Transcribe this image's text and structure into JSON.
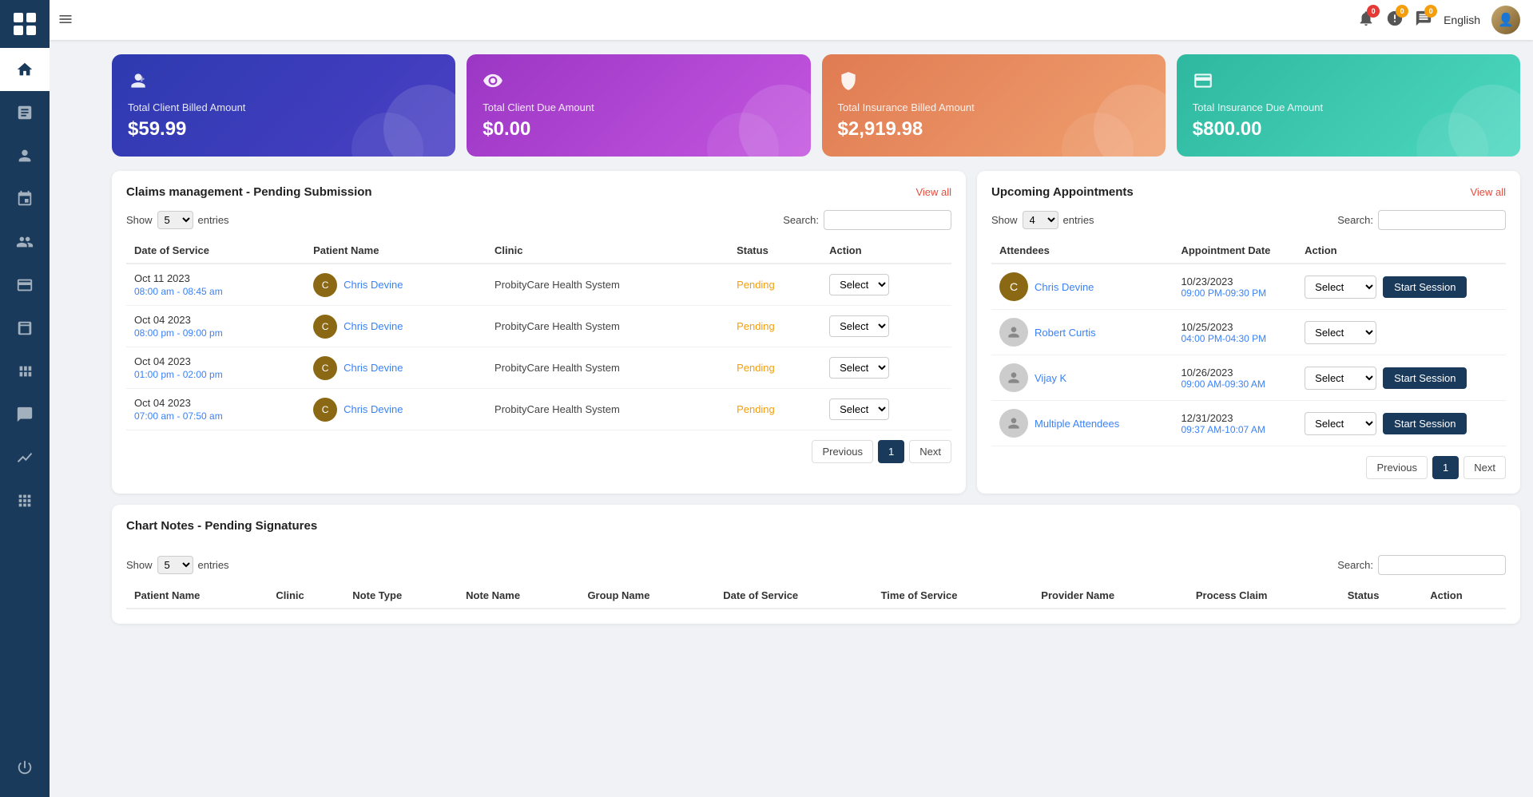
{
  "topbar": {
    "hamburger_label": "☰",
    "language": "English",
    "notification_count": "0",
    "alert_count": "0",
    "message_count": "0"
  },
  "summary_cards": [
    {
      "id": "total-client-billed",
      "title": "Total Client Billed Amount",
      "amount": "$59.99",
      "color": "card-1"
    },
    {
      "id": "total-client-due",
      "title": "Total Client Due Amount",
      "amount": "$0.00",
      "color": "card-2"
    },
    {
      "id": "total-insurance-billed",
      "title": "Total Insurance Billed Amount",
      "amount": "$2,919.98",
      "color": "card-3"
    },
    {
      "id": "total-insurance-due",
      "title": "Total Insurance Due Amount",
      "amount": "$800.00",
      "color": "card-4"
    }
  ],
  "claims": {
    "title": "Claims management - Pending Submission",
    "view_all": "View all",
    "show_label": "Show",
    "entries_label": "entries",
    "search_label": "Search:",
    "show_count": "5",
    "columns": [
      "Date of Service",
      "Patient Name",
      "Clinic",
      "Status",
      "Action"
    ],
    "rows": [
      {
        "date": "Oct 11 2023",
        "time": "08:00 am - 08:45 am",
        "patient": "Chris Devine",
        "clinic": "ProbityCare Health System",
        "status": "Pending"
      },
      {
        "date": "Oct 04 2023",
        "time": "08:00 pm - 09:00 pm",
        "patient": "Chris Devine",
        "clinic": "ProbityCare Health System",
        "status": "Pending"
      },
      {
        "date": "Oct 04 2023",
        "time": "01:00 pm - 02:00 pm",
        "patient": "Chris Devine",
        "clinic": "ProbityCare Health System",
        "status": "Pending"
      },
      {
        "date": "Oct 04 2023",
        "time": "07:00 am - 07:50 am",
        "patient": "Chris Devine",
        "clinic": "ProbityCare Health System",
        "status": "Pending"
      }
    ],
    "pagination": {
      "previous": "Previous",
      "next": "Next",
      "current_page": 1
    }
  },
  "appointments": {
    "title": "Upcoming Appointments",
    "view_all": "View all",
    "show_label": "Show",
    "entries_label": "entries",
    "show_count": "4",
    "search_label": "Search:",
    "columns": [
      "Attendees",
      "Appointment Date",
      "Action"
    ],
    "rows": [
      {
        "name": "Chris Devine",
        "has_photo": true,
        "date": "10/23/2023",
        "time": "09:00 PM-09:30 PM",
        "has_start": true
      },
      {
        "name": "Robert Curtis",
        "has_photo": false,
        "date": "10/25/2023",
        "time": "04:00 PM-04:30 PM",
        "has_start": false
      },
      {
        "name": "Vijay K",
        "has_photo": false,
        "date": "10/26/2023",
        "time": "09:00 AM-09:30 AM",
        "has_start": true
      },
      {
        "name": "Multiple Attendees",
        "has_photo": false,
        "date": "12/31/2023",
        "time": "09:37 AM-10:07 AM",
        "has_start": true
      }
    ],
    "select_label": "Select",
    "start_session_label": "Start Session",
    "pagination": {
      "previous": "Previous",
      "next": "Next",
      "current_page": 1
    }
  },
  "chart_notes": {
    "title": "Chart Notes - Pending Signatures",
    "show_label": "Show",
    "show_count": "5",
    "entries_label": "entries",
    "search_label": "Search:",
    "columns": [
      "Patient Name",
      "Clinic",
      "Note Type",
      "Note Name",
      "Group Name",
      "Date of Service",
      "Time of Service",
      "Provider Name",
      "Process Claim",
      "Status",
      "Action"
    ]
  },
  "sidebar": {
    "items": [
      {
        "id": "home",
        "label": "Home",
        "active": true
      },
      {
        "id": "records",
        "label": "Records"
      },
      {
        "id": "clients",
        "label": "Clients"
      },
      {
        "id": "schedule",
        "label": "Schedule"
      },
      {
        "id": "group",
        "label": "Group"
      },
      {
        "id": "billing",
        "label": "Billing"
      },
      {
        "id": "calendar",
        "label": "Calendar"
      },
      {
        "id": "widgets",
        "label": "Widgets"
      },
      {
        "id": "broadcast",
        "label": "Broadcast"
      },
      {
        "id": "analytics",
        "label": "Analytics"
      },
      {
        "id": "apps",
        "label": "Apps"
      },
      {
        "id": "power",
        "label": "Power"
      }
    ]
  }
}
